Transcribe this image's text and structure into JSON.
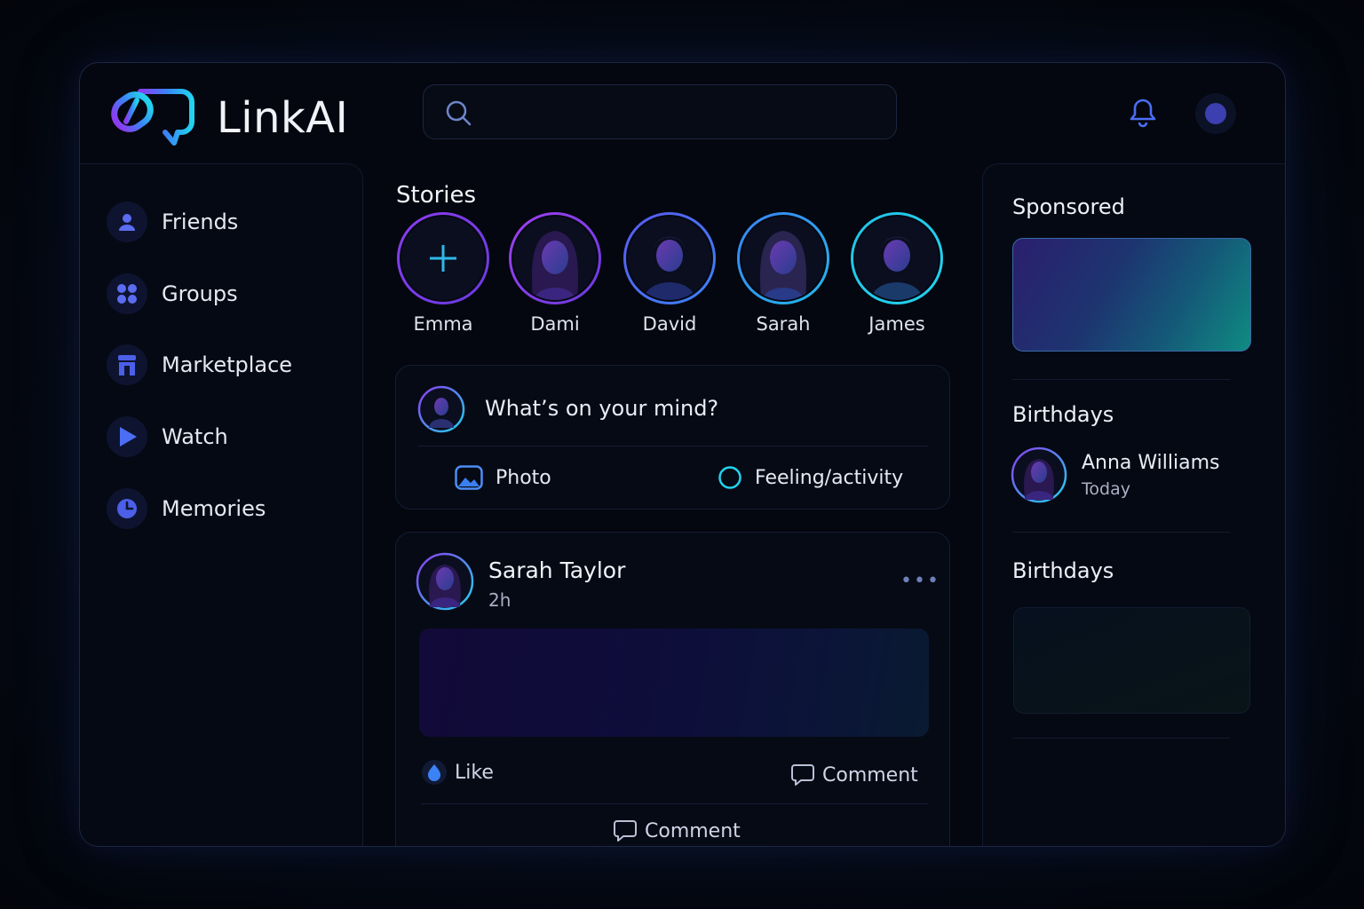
{
  "app": {
    "name": "LinkAI"
  },
  "search": {
    "placeholder": ""
  },
  "sidebar": {
    "items": [
      {
        "label": "Friends",
        "icon": "person-icon"
      },
      {
        "label": "Groups",
        "icon": "groups-icon"
      },
      {
        "label": "Marketplace",
        "icon": "marketplace-icon"
      },
      {
        "label": "Watch",
        "icon": "play-icon"
      },
      {
        "label": "Memories",
        "icon": "clock-icon"
      }
    ]
  },
  "stories": {
    "title": "Stories",
    "items": [
      {
        "name": "Emma",
        "type": "add"
      },
      {
        "name": "Dami",
        "type": "female"
      },
      {
        "name": "David",
        "type": "male"
      },
      {
        "name": "Sarah",
        "type": "female"
      },
      {
        "name": "James",
        "type": "male"
      }
    ]
  },
  "composer": {
    "prompt": "What’s on your mind?",
    "photo_label": "Photo",
    "feeling_label": "Feeling/activity"
  },
  "post": {
    "author": "Sarah Taylor",
    "time": "2h",
    "more": "•••",
    "like_label": "Like",
    "comment_label": "Comment",
    "comment_center_label": "Comment"
  },
  "right": {
    "sponsored_title": "Sponsored",
    "birthdays_title": "Birthdays",
    "birthday_person": "Anna Williams",
    "birthday_when": "Today",
    "birthdays_title_2": "Birthdays"
  },
  "colors": {
    "accent_purple": "#7c3aed",
    "accent_blue": "#3b5bdb",
    "accent_cyan": "#22d3ee",
    "background": "#04070f"
  }
}
